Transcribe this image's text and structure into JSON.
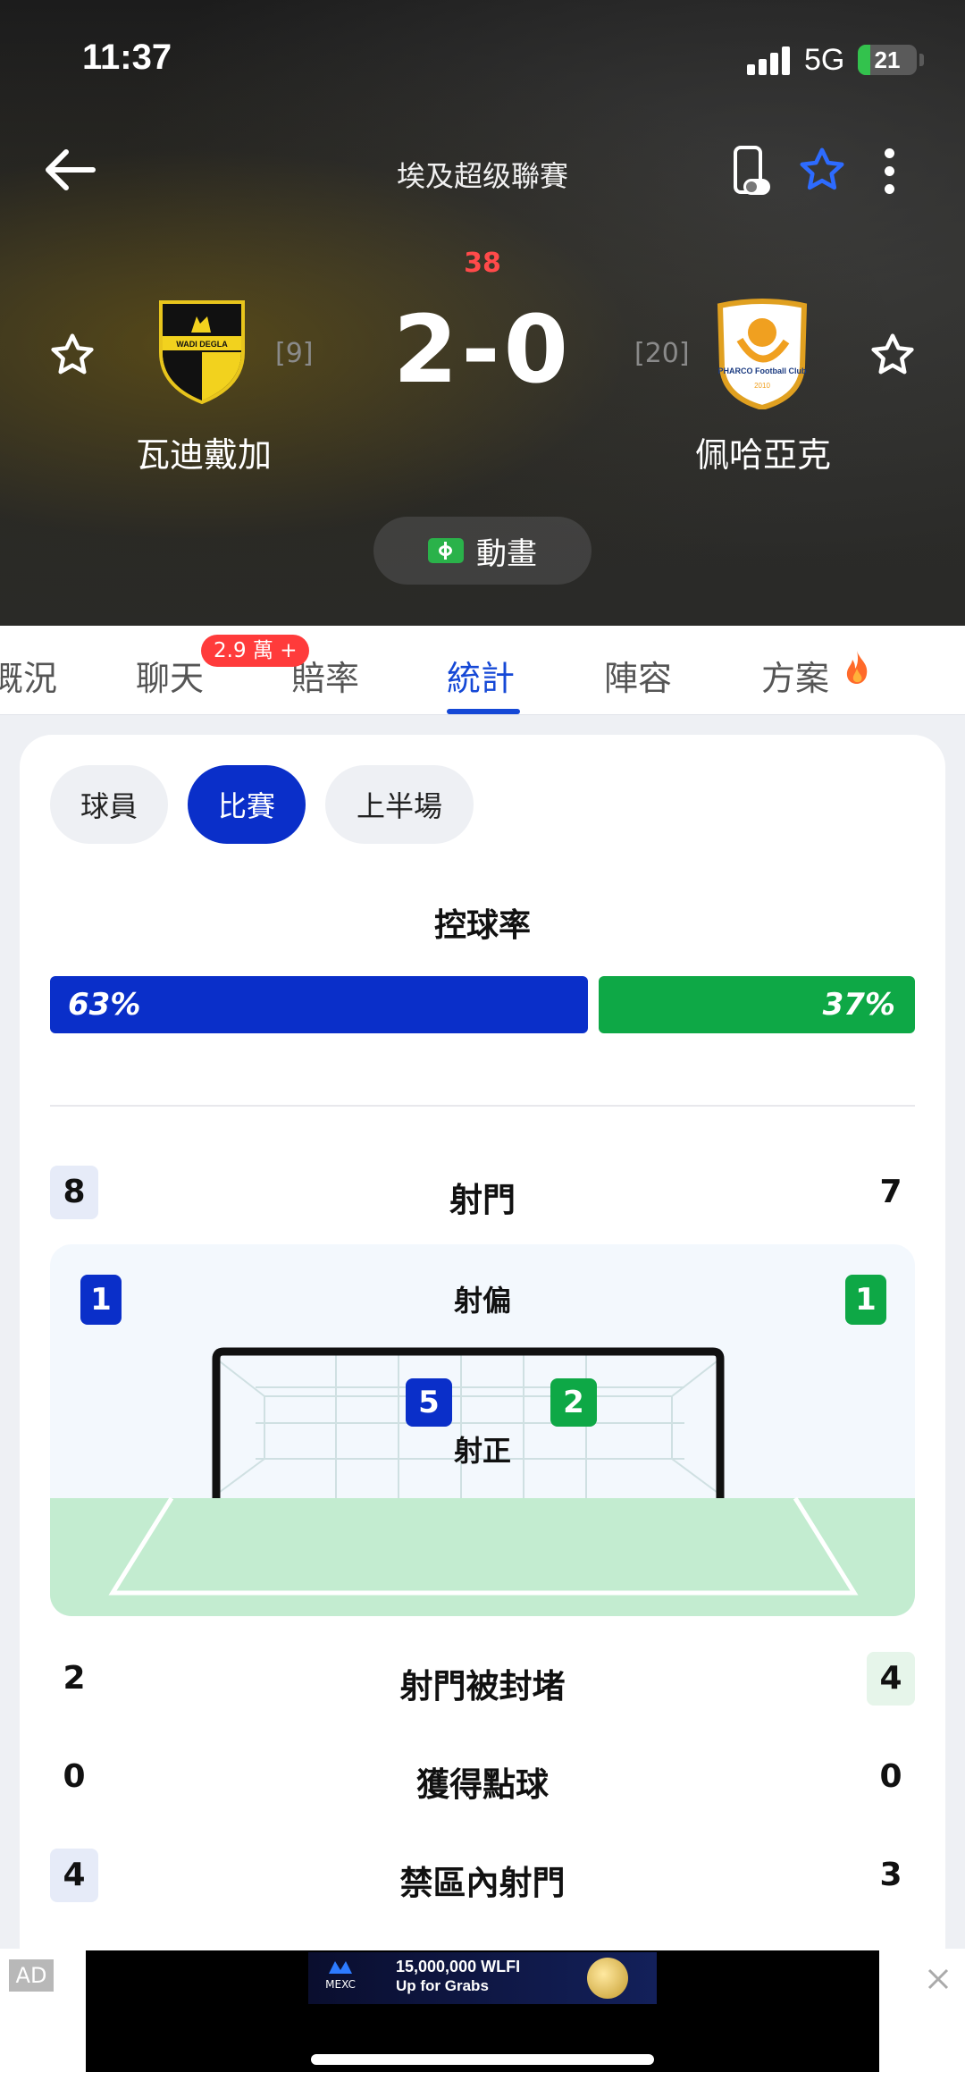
{
  "status_bar": {
    "time": "11:37",
    "network": "5G",
    "battery": "21",
    "battery_level": 0.21
  },
  "header": {
    "league": "埃及超级聯賽",
    "minute": "38",
    "score": "2-0",
    "home_team": {
      "name": "瓦迪戴加",
      "rank": "[9]",
      "crest_text": "WADI DEGLA"
    },
    "away_team": {
      "name": "佩哈亞克",
      "rank": "[20]",
      "crest_text": "PHARCO Football Club",
      "crest_year": "2010"
    },
    "animation_label": "動畫",
    "colors": {
      "minute": "#ff4a4a",
      "star_active": "#2d6bff"
    }
  },
  "tabs": {
    "items": [
      {
        "label": "概況"
      },
      {
        "label": "聊天",
        "badge": "2.9 萬 +"
      },
      {
        "label": "賠率"
      },
      {
        "label": "統計",
        "active": true
      },
      {
        "label": "陣容"
      },
      {
        "label": "方案",
        "icon": "fire-icon"
      }
    ]
  },
  "filters": {
    "items": [
      {
        "label": "球員"
      },
      {
        "label": "比賽",
        "active": true
      },
      {
        "label": "上半場"
      }
    ]
  },
  "possession": {
    "title": "控球率",
    "home": "63%",
    "away": "37%",
    "home_pct": 63,
    "away_pct": 37
  },
  "shots": {
    "title": "射門",
    "home": "8",
    "away": "7",
    "off_target": {
      "label": "射偏",
      "home": "1",
      "away": "1"
    },
    "on_target": {
      "label": "射正",
      "home": "5",
      "away": "2"
    }
  },
  "stats": [
    {
      "label": "射門被封堵",
      "home": "2",
      "away": "4"
    },
    {
      "label": "獲得點球",
      "home": "0",
      "away": "0"
    },
    {
      "label": "禁區內射門",
      "home": "4",
      "away": "3"
    }
  ],
  "ad": {
    "tag": "AD",
    "brand": "MEXC",
    "headline": "15,000,000 WLFI",
    "subline": "Up for Grabs"
  },
  "colors": {
    "home": "#0a2fc9",
    "away": "#0ea846",
    "tab_active": "#1548d6"
  }
}
